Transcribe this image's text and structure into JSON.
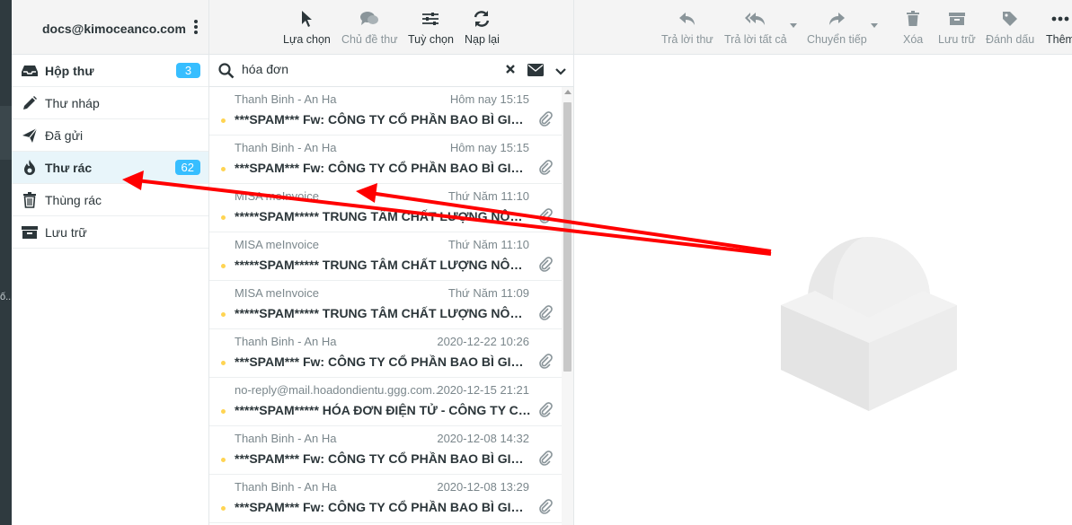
{
  "account": {
    "email": "docs@kimoceanco.com"
  },
  "left_strip_mark": "ố...",
  "folders": [
    {
      "label": "Hộp thư",
      "count": "3",
      "icon": "inbox-icon"
    },
    {
      "label": "Thư nháp",
      "count": "",
      "icon": "pencil-icon"
    },
    {
      "label": "Đã gửi",
      "count": "",
      "icon": "send-icon"
    },
    {
      "label": "Thư rác",
      "count": "62",
      "icon": "fire-icon"
    },
    {
      "label": "Thùng rác",
      "count": "",
      "icon": "trash-icon"
    },
    {
      "label": "Lưu trữ",
      "count": "",
      "icon": "archive-icon"
    }
  ],
  "list_toolbar": {
    "select": "Lựa chọn",
    "threads": "Chủ đề thư",
    "options": "Tuỳ chọn",
    "refresh": "Nạp lại"
  },
  "search": {
    "value": "hóa đơn"
  },
  "messages": [
    {
      "from": "Thanh Binh - An Ha",
      "date": "Hôm nay 15:15",
      "subject": "***SPAM*** Fw: CÔNG TY CỔ PHẦN BAO BÌ GIẤY ..."
    },
    {
      "from": "Thanh Binh - An Ha",
      "date": "Hôm nay 15:15",
      "subject": "***SPAM*** Fw: CÔNG TY CỔ PHẦN BAO BÌ GIẤY ..."
    },
    {
      "from": "MISA meInvoice",
      "date": "Thứ Năm 11:10",
      "subject": "*****SPAM***** TRUNG TÂM CHẤT LƯỢNG NÔNG..."
    },
    {
      "from": "MISA meInvoice",
      "date": "Thứ Năm 11:10",
      "subject": "*****SPAM***** TRUNG TÂM CHẤT LƯỢNG NÔNG..."
    },
    {
      "from": "MISA meInvoice",
      "date": "Thứ Năm 11:09",
      "subject": "*****SPAM***** TRUNG TÂM CHẤT LƯỢNG NÔNG..."
    },
    {
      "from": "Thanh Binh - An Ha",
      "date": "2020-12-22 10:26",
      "subject": "***SPAM*** Fw: CÔNG TY CỔ PHẦN BAO BÌ GIẤY ..."
    },
    {
      "from": "no-reply@mail.hoadondientu.ggg.com...",
      "date": "2020-12-15 21:21",
      "subject": "*****SPAM***** HÓA ĐƠN ĐIỆN TỬ - CÔNG TY CỔ..."
    },
    {
      "from": "Thanh Binh - An Ha",
      "date": "2020-12-08 14:32",
      "subject": "***SPAM*** Fw: CÔNG TY CỔ PHẦN BAO BÌ GIẤY ..."
    },
    {
      "from": "Thanh Binh - An Ha",
      "date": "2020-12-08 13:29",
      "subject": "***SPAM*** Fw: CÔNG TY CỔ PHẦN BAO BÌ GIẤY ..."
    }
  ],
  "message_toolbar": {
    "reply": "Trả lời thư",
    "reply_all": "Trả lời tất cả",
    "forward": "Chuyển tiếp",
    "delete": "Xóa",
    "archive": "Lưu trữ",
    "mark": "Đánh dấu",
    "more": "Thêm"
  },
  "colors": {
    "accent": "#37beff",
    "selected_bg": "#e8f5fa",
    "unread_dot": "#ffd452",
    "annotation_arrow": "#ff0000"
  }
}
